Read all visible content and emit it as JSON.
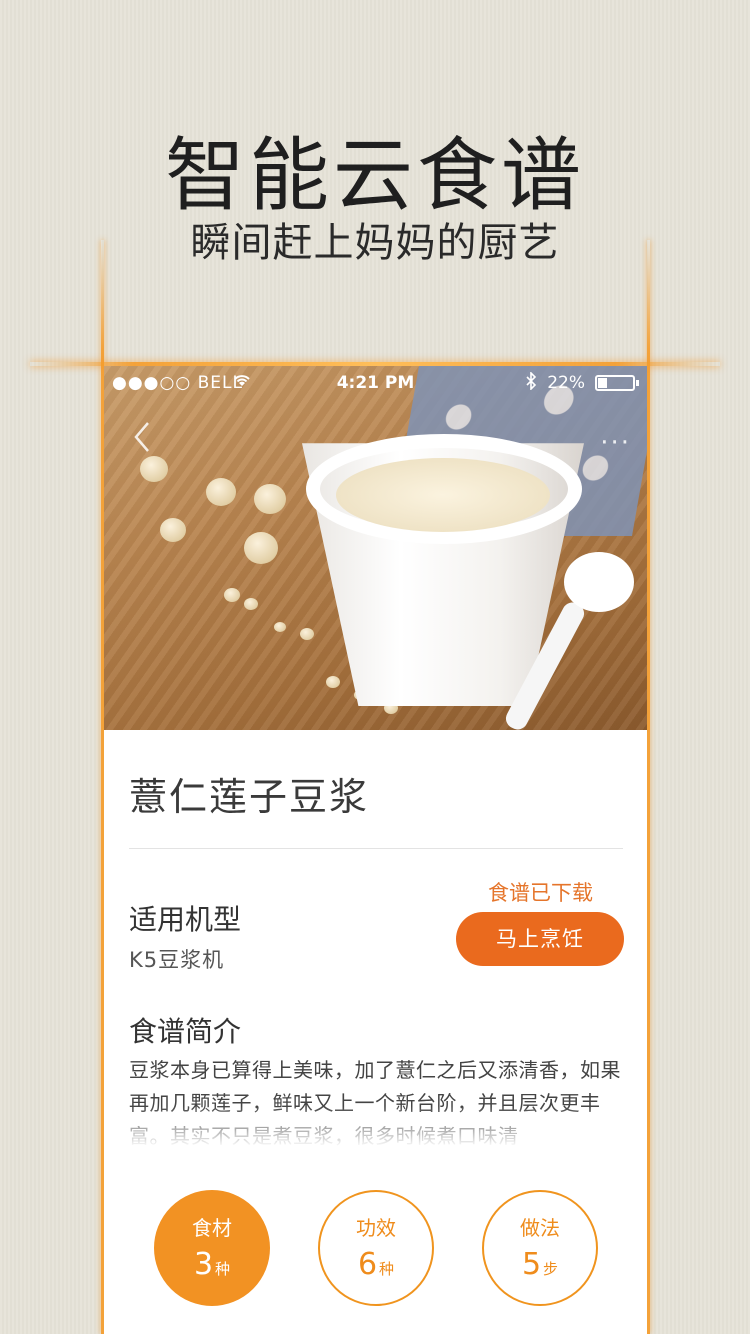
{
  "promo": {
    "headline": "智能云食谱",
    "subheadline": "瞬间赶上妈妈的厨艺"
  },
  "status_bar": {
    "carrier": "●●●○○ BELL",
    "time": "4:21 PM",
    "battery": "22%"
  },
  "recipe": {
    "title": "薏仁莲子豆浆",
    "model_label": "适用机型",
    "model_value": "K5豆浆机",
    "download_status": "食谱已下载",
    "cook_button": "马上烹饪",
    "intro_label": "食谱简介",
    "intro_text": "豆浆本身已算得上美味，加了薏仁之后又添清香，如果再加几颗莲子，鲜味又上一个新台阶，并且层次更丰富。其实不只是煮豆浆，很多时候煮口味清"
  },
  "tabs": [
    {
      "title": "食材",
      "count": "3",
      "unit": "种"
    },
    {
      "title": "功效",
      "count": "6",
      "unit": "种"
    },
    {
      "title": "做法",
      "count": "5",
      "unit": "步"
    }
  ],
  "colors": {
    "accent_orange": "#ea6a1e",
    "tab_active": "#f29223",
    "glow": "#f59b28"
  },
  "icons": [
    "back-icon",
    "more-icon",
    "wifi-icon",
    "bluetooth-icon",
    "battery-icon"
  ]
}
